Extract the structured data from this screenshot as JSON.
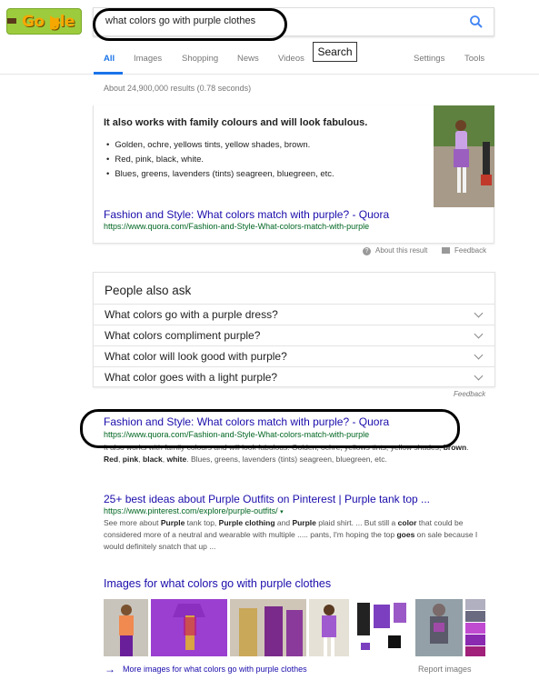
{
  "logo": {
    "text": "Go gle"
  },
  "search": {
    "query": "what colors go with purple clothes",
    "tooltip": "Search"
  },
  "tabs": [
    "All",
    "Images",
    "Shopping",
    "News",
    "Videos",
    "Settings",
    "Tools"
  ],
  "result_stats": "About 24,900,000 results (0.78 seconds)",
  "featured_snippet": {
    "heading": "It also works with family colours and will look fabulous.",
    "bullets": [
      "Golden, ochre, yellows tints, yellow shades, brown.",
      "Red, pink, black, white.",
      "Blues, greens, lavenders (tints) seagreen, bluegreen, etc."
    ],
    "link_title": "Fashion and Style: What colors match with purple? - Quora",
    "url": "https://www.quora.com/Fashion-and-Style-What-colors-match-with-purple",
    "about": "About this result",
    "feedback": "Feedback"
  },
  "people_also_ask": {
    "title": "People also ask",
    "questions": [
      "What colors go with a purple dress?",
      "What colors compliment purple?",
      "What color will look good with purple?",
      "What color goes with a light purple?"
    ],
    "feedback": "Feedback"
  },
  "results": [
    {
      "title": "Fashion and Style: What colors match with purple? - Quora",
      "url": "https://www.quora.com/Fashion-and-Style-What-colors-match-with-purple",
      "snippet_html": "It also works with family colours and will look fabulous. Golden, ochre, yellows tints, yellow shades, <b>brown</b>. <b>Red</b>, <b>pink</b>, <b>black</b>, <b>white</b>. Blues, greens, lavenders (tints) seagreen, bluegreen, etc."
    },
    {
      "title": "25+ best ideas about Purple Outfits on Pinterest | Purple tank top ...",
      "url": "https://www.pinterest.com/explore/purple-outfits/",
      "snippet_html": "See more about <b>Purple</b> tank top, <b>Purple clothing</b> and <b>Purple</b> plaid shirt. ... But still a <b>color</b> that could be considered more of a neutral and wearable with multiple ..... pants, I'm hoping the top <b>goes</b> on sale because I would definitely snatch that up ..."
    }
  ],
  "images_section": {
    "title": "Images for what colors go with purple clothes",
    "more_link": "More images for what colors go with purple clothes",
    "report": "Report images"
  },
  "colors": {
    "link": "#1a0dab",
    "url": "#006621",
    "accent": "#1a73e8",
    "purple": "#8a2be2"
  }
}
